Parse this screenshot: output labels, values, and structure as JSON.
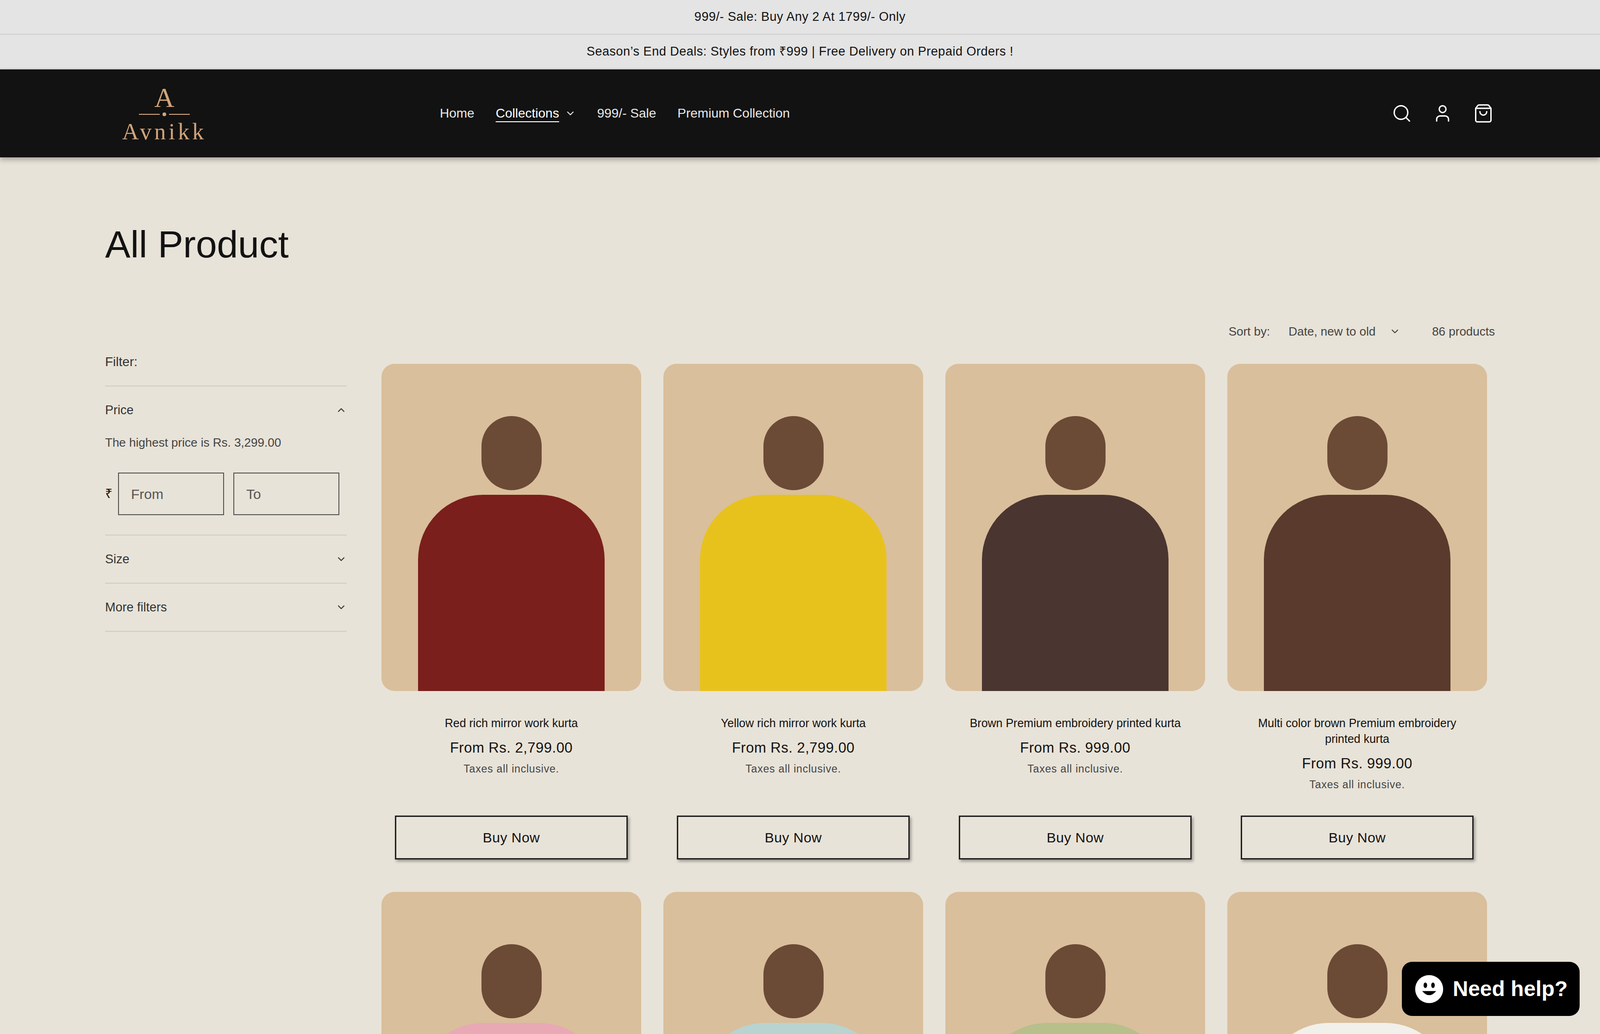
{
  "announcements": [
    "999/- Sale: Buy Any 2 At 1799/- Only",
    "Season’s End Deals: Styles from ₹999 | Free Delivery on Prepaid Orders !"
  ],
  "logo": {
    "monogram": "A",
    "name": "Avnikk"
  },
  "nav": [
    {
      "label": "Home",
      "selected": false,
      "dropdown": false
    },
    {
      "label": "Collections",
      "selected": true,
      "dropdown": true
    },
    {
      "label": "999/- Sale",
      "selected": false,
      "dropdown": false
    },
    {
      "label": "Premium Collection",
      "selected": false,
      "dropdown": false
    }
  ],
  "page_title": "All Product",
  "filter": {
    "label": "Filter:",
    "groups": [
      {
        "label": "Price",
        "expanded": true,
        "highest": "The highest price is Rs. 3,299.00",
        "currency": "₹",
        "from_placeholder": "From",
        "to_placeholder": "To"
      },
      {
        "label": "Size",
        "expanded": false
      },
      {
        "label": "More filters",
        "expanded": false
      }
    ]
  },
  "sort": {
    "label": "Sort by:",
    "value": "Date, new to old",
    "count": "86 products"
  },
  "products": [
    {
      "name": "Red rich mirror work kurta",
      "price": "From Rs. 2,799.00",
      "tax": "Taxes all inclusive.",
      "button": "Buy Now",
      "color": "#7a1f1c"
    },
    {
      "name": "Yellow rich mirror work kurta",
      "price": "From Rs. 2,799.00",
      "tax": "Taxes all inclusive.",
      "button": "Buy Now",
      "color": "#e8c21c"
    },
    {
      "name": "Brown Premium embroidery printed kurta",
      "price": "From Rs. 999.00",
      "tax": "Taxes all inclusive.",
      "button": "Buy Now",
      "color": "#4a3530"
    },
    {
      "name": "Multi color brown Premium embroidery printed kurta",
      "price": "From Rs. 999.00",
      "tax": "Taxes all inclusive.",
      "button": "Buy Now",
      "color": "#5a3a2c"
    }
  ],
  "partially_visible_products": [
    {
      "color": "#e8a9b4"
    },
    {
      "color": "#b9d3d0"
    },
    {
      "color": "#b7bf8a"
    },
    {
      "color": "#f2f0ea"
    }
  ],
  "chat": {
    "label": "Need help?"
  }
}
